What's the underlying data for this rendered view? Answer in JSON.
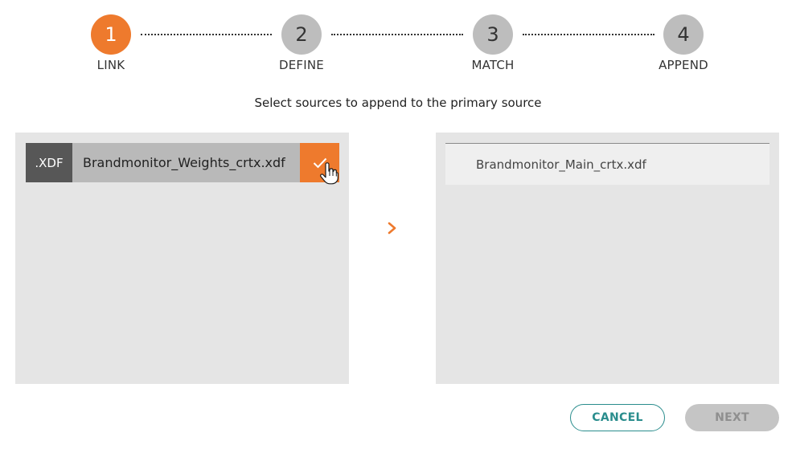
{
  "stepper": {
    "steps": [
      {
        "number": "1",
        "label": "LINK",
        "active": true
      },
      {
        "number": "2",
        "label": "DEFINE",
        "active": false
      },
      {
        "number": "3",
        "label": "MATCH",
        "active": false
      },
      {
        "number": "4",
        "label": "APPEND",
        "active": false
      }
    ]
  },
  "instruction": "Select sources to append to the primary source",
  "available_sources": {
    "items": [
      {
        "badge": ".XDF",
        "name": "Brandmonitor_Weights_crtx.xdf",
        "selected": true
      }
    ]
  },
  "primary_source": {
    "name": "Brandmonitor_Main_crtx.xdf"
  },
  "buttons": {
    "cancel": "CANCEL",
    "next": "NEXT"
  },
  "colors": {
    "accent": "#ee7a2d",
    "teal": "#2a8d8d",
    "inactive_step": "#bdbdbd",
    "panel_bg": "#e5e5e5"
  }
}
